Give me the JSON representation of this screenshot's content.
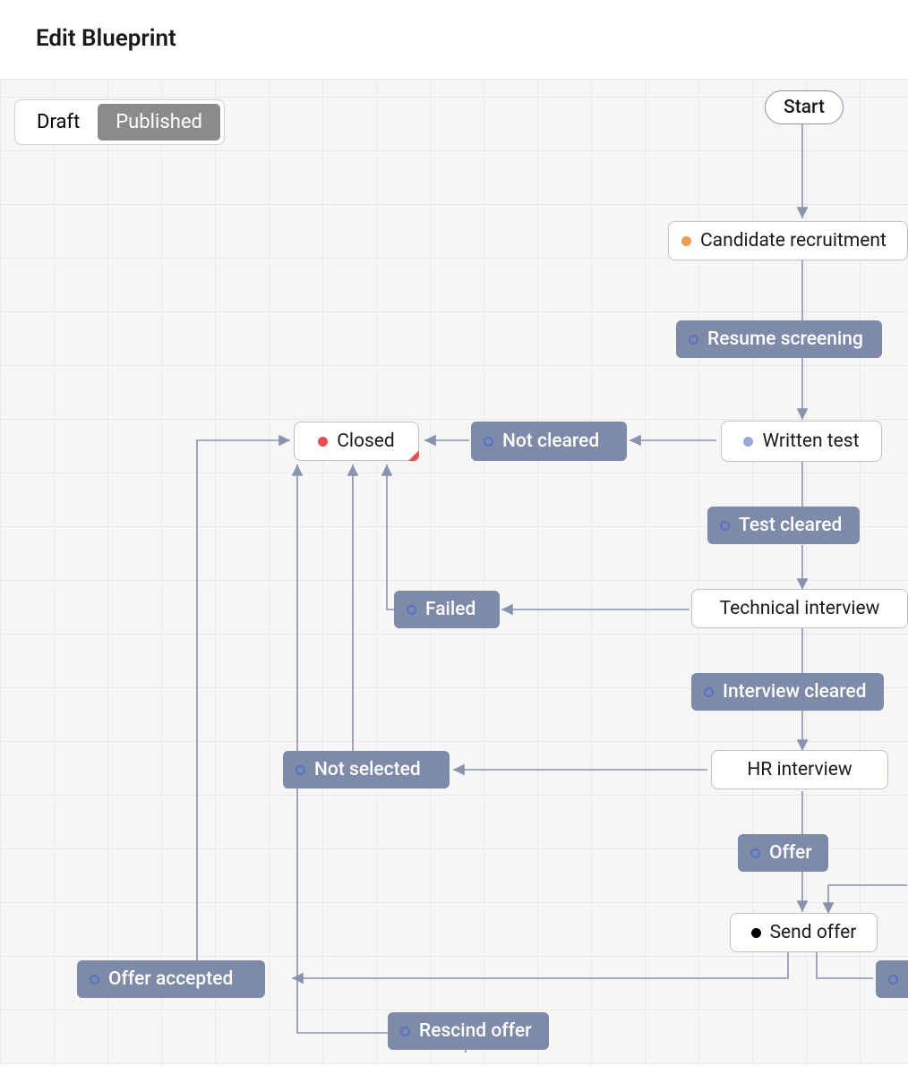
{
  "header": {
    "title": "Edit Blueprint"
  },
  "toggle": {
    "draft": "Draft",
    "published": "Published",
    "active": "Published"
  },
  "nodes": {
    "start": "Start",
    "candidate_recruitment": "Candidate recruitment",
    "resume_screening": "Resume screening",
    "written_test": "Written test",
    "test_cleared": "Test cleared",
    "technical_interview": "Technical interview",
    "interview_cleared": "Interview cleared",
    "hr_interview": "HR interview",
    "offer": "Offer",
    "send_offer": "Send offer",
    "closed": "Closed",
    "not_cleared": "Not cleared",
    "failed": "Failed",
    "not_selected": "Not selected",
    "offer_accepted": "Offer accepted",
    "rescind_offer": "Rescind offer"
  },
  "colors": {
    "transition_bg": "#7d8aa8",
    "state_border": "#bcc2d2",
    "canvas_bg": "#f6f6f6",
    "arrow": "#8a93ad"
  }
}
